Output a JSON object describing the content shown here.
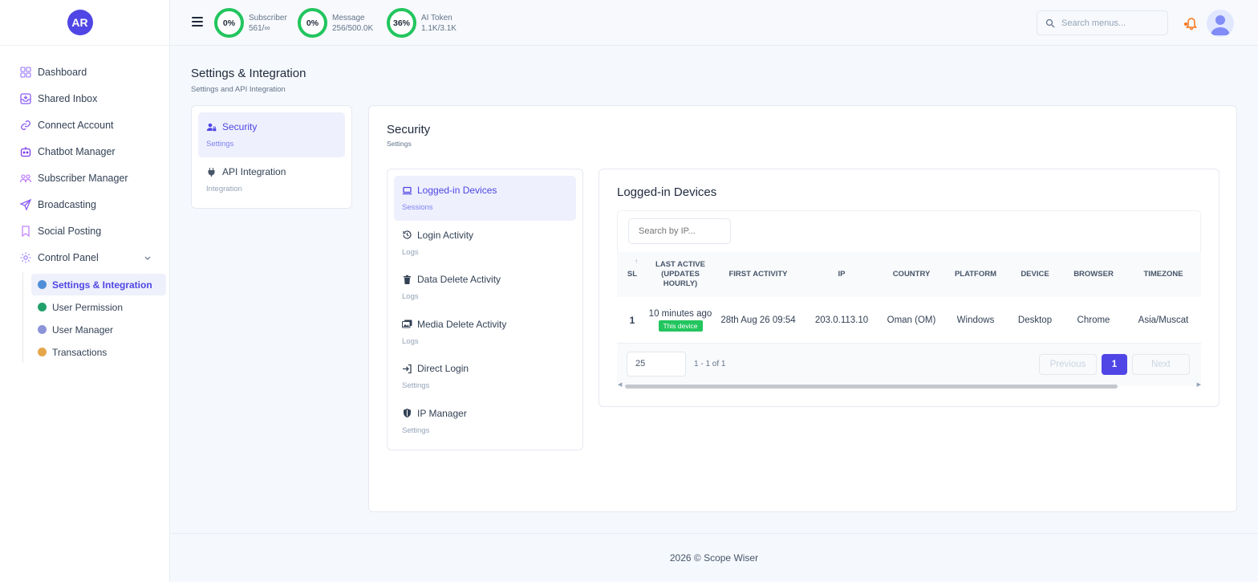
{
  "sidebar": {
    "avatar_initials": "AR",
    "items": [
      {
        "label": "Dashboard"
      },
      {
        "label": "Shared Inbox"
      },
      {
        "label": "Connect Account"
      },
      {
        "label": "Chatbot Manager"
      },
      {
        "label": "Subscriber Manager"
      },
      {
        "label": "Broadcasting"
      },
      {
        "label": "Social Posting"
      },
      {
        "label": "Control Panel"
      }
    ],
    "sub_items": [
      {
        "label": "Settings & Integration",
        "color": "#4f8fd9"
      },
      {
        "label": "User Permission",
        "color": "#22a06b"
      },
      {
        "label": "User Manager",
        "color": "#8b93d9"
      },
      {
        "label": "Transactions",
        "color": "#e5a64a"
      }
    ]
  },
  "topbar": {
    "stats": [
      {
        "percent": "0%",
        "label": "Subscriber",
        "value": "561/∞"
      },
      {
        "percent": "0%",
        "label": "Message",
        "value": "256/500.0K"
      },
      {
        "percent": "36%",
        "label": "AI Token",
        "value": "1.1K/3.1K"
      }
    ],
    "search_placeholder": "Search menus..."
  },
  "page": {
    "title": "Settings & Integration",
    "subtitle": "Settings and API Integration"
  },
  "tabs": [
    {
      "label": "Security",
      "sub": "Settings"
    },
    {
      "label": "API Integration",
      "sub": "Integration"
    }
  ],
  "security": {
    "title": "Security",
    "subtitle": "Settings",
    "items": [
      {
        "label": "Logged-in Devices",
        "sub": "Sessions"
      },
      {
        "label": "Login Activity",
        "sub": "Logs"
      },
      {
        "label": "Data Delete Activity",
        "sub": "Logs"
      },
      {
        "label": "Media Delete Activity",
        "sub": "Logs"
      },
      {
        "label": "Direct Login",
        "sub": "Settings"
      },
      {
        "label": "IP Manager",
        "sub": "Settings"
      }
    ]
  },
  "devices": {
    "title": "Logged-in Devices",
    "search_placeholder": "Search by IP...",
    "columns": [
      "SL",
      "LAST ACTIVE (UPDATES HOURLY)",
      "FIRST ACTIVITY",
      "IP",
      "COUNTRY",
      "PLATFORM",
      "DEVICE",
      "BROWSER",
      "TIMEZONE"
    ],
    "rows": [
      {
        "sl": "1",
        "last_active": "10 minutes ago",
        "badge": "This device",
        "first_activity": "28th Aug 26 09:54",
        "ip": "203.0.113.10",
        "country": "Oman (OM)",
        "platform": "Windows",
        "device": "Desktop",
        "browser": "Chrome",
        "timezone": "Asia/Muscat"
      }
    ],
    "per_page": "25",
    "range": "1 - 1 of 1",
    "prev_label": "Previous",
    "page": "1",
    "next_label": "Next"
  },
  "footer": {
    "text": "2026 © Scope Wiser"
  }
}
